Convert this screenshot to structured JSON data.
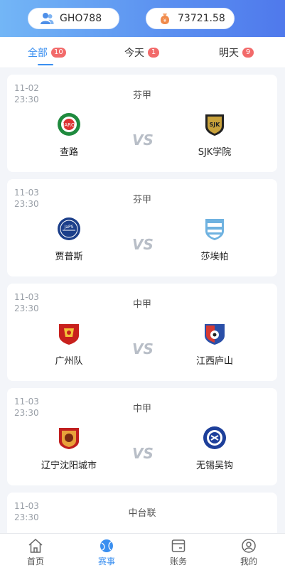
{
  "header": {
    "username": "GHO788",
    "balance": "73721.58"
  },
  "tabs": [
    {
      "label": "全部",
      "count": "10"
    },
    {
      "label": "今天",
      "count": "1"
    },
    {
      "label": "明天",
      "count": "9"
    }
  ],
  "matches": [
    {
      "date": "11-02",
      "time": "23:30",
      "league": "芬甲",
      "home": "查路",
      "away": "SJK学院"
    },
    {
      "date": "11-03",
      "time": "23:30",
      "league": "芬甲",
      "home": "贾普斯",
      "away": "莎埃帕"
    },
    {
      "date": "11-03",
      "time": "23:30",
      "league": "中甲",
      "home": "广州队",
      "away": "江西庐山"
    },
    {
      "date": "11-03",
      "time": "23:30",
      "league": "中甲",
      "home": "辽宁沈阳城市",
      "away": "无锡吴钩"
    },
    {
      "date": "11-03",
      "time": "23:30",
      "league": "中台联",
      "home": "",
      "away": ""
    }
  ],
  "bottom_nav": [
    {
      "label": "首页",
      "icon": "home-icon"
    },
    {
      "label": "赛事",
      "icon": "ball-icon"
    },
    {
      "label": "账务",
      "icon": "wallet-icon"
    },
    {
      "label": "我的",
      "icon": "user-icon"
    }
  ],
  "colors": {
    "accent": "#3a8ff0",
    "badge": "#f26a6a",
    "header_start": "#73b6f6",
    "header_end": "#4f79ec"
  }
}
